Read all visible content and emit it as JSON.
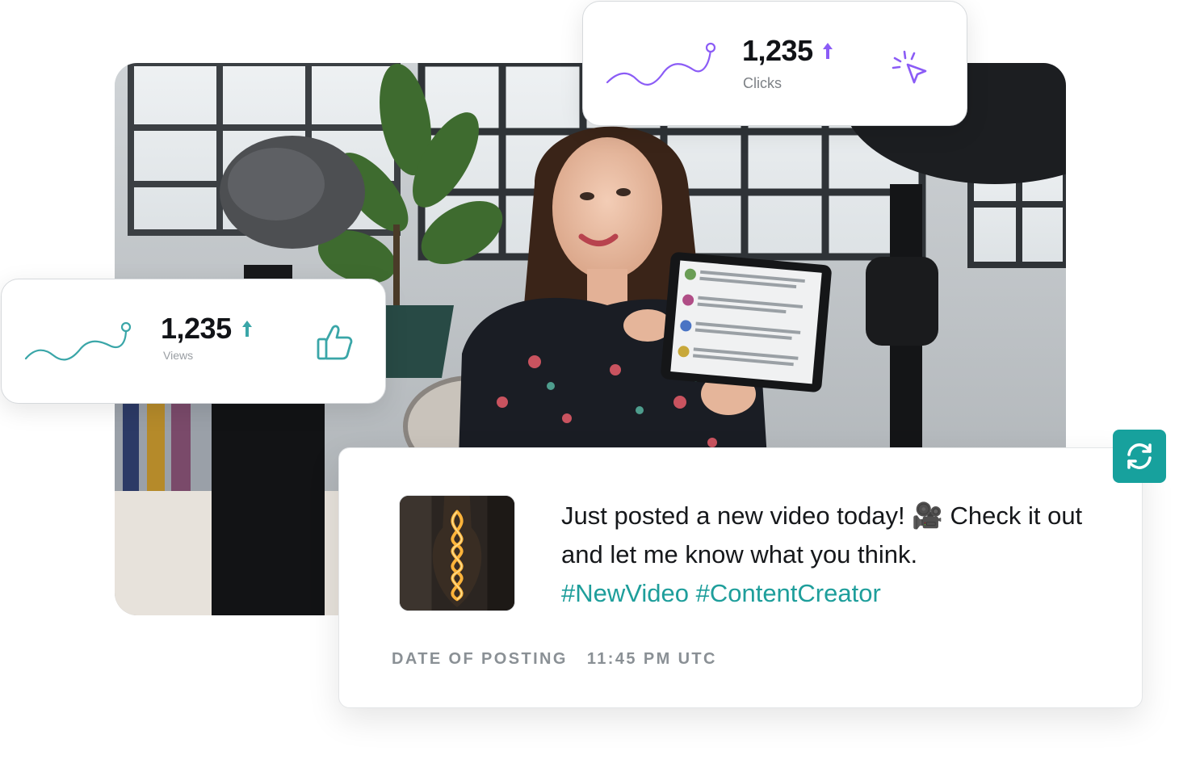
{
  "colors": {
    "teal_accent": "#17a19d",
    "hashtag": "#1e9e9b",
    "clicks_purple": "#8b5cf6",
    "views_teal": "#3aa6a8",
    "meta_gray": "#8a9095"
  },
  "hero": {
    "image": "woman-vlogger-holding-tablet-photo",
    "tablet_comments": [
      "I_Live_4_MakeUp",
      "MakeMeUp_",
      "JillWarr_N",
      "AshMurrayMUA_1"
    ]
  },
  "stats": {
    "clicks": {
      "value": "1,235",
      "label": "Clicks",
      "trend_icon": "arrow-up-icon",
      "icon": "cursor-click-icon",
      "color": "#8b5cf6"
    },
    "views": {
      "value": "1,235",
      "label": "Views",
      "trend_icon": "arrow-up-icon",
      "icon": "thumbs-up-icon",
      "color": "#3aa6a8"
    }
  },
  "post": {
    "text": "Just posted a new video today! 🎥 Check it out and let me know what you think.",
    "hashtags": "#NewVideo #ContentCreator",
    "thumbnail": "lightbulb-filament-image",
    "meta_label": "DATE OF POSTING",
    "meta_time": "11:45 PM UTC",
    "repost_icon": "refresh-icon"
  }
}
